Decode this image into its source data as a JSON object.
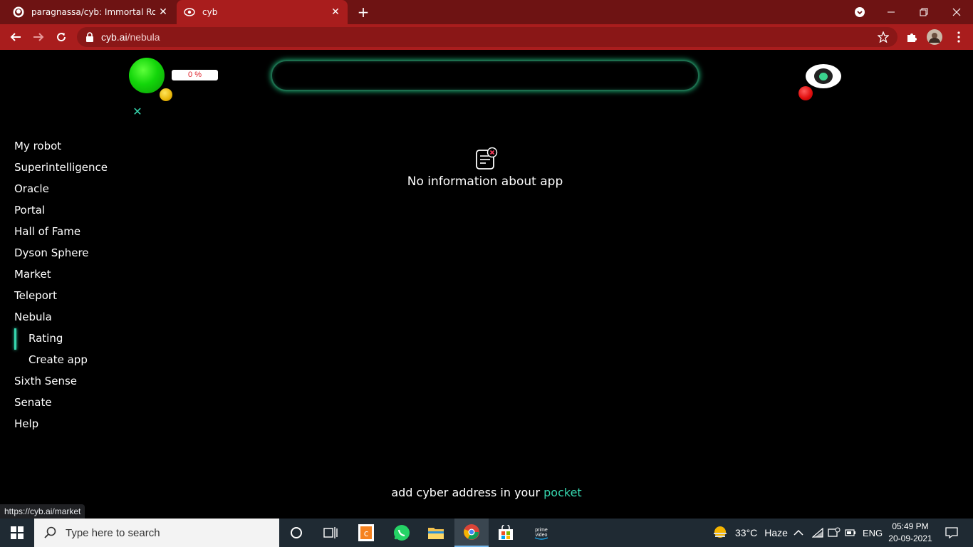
{
  "browser": {
    "tabs": [
      {
        "title": "paragnassa/cyb: Immortal Robot",
        "favicon": "github-icon"
      },
      {
        "title": "cyb",
        "favicon": "cyb-icon"
      }
    ],
    "url_host": "cyb.ai",
    "url_path": "/nebula",
    "colors": {
      "frame": "#6e1313",
      "toolbar": "#a91d1d"
    }
  },
  "header": {
    "progress_label": "0 %"
  },
  "sidebar": {
    "items": [
      {
        "label": "My robot"
      },
      {
        "label": "Superintelligence"
      },
      {
        "label": "Oracle"
      },
      {
        "label": "Portal"
      },
      {
        "label": "Hall of Fame"
      },
      {
        "label": "Dyson Sphere"
      },
      {
        "label": "Market"
      },
      {
        "label": "Teleport"
      },
      {
        "label": "Nebula"
      },
      {
        "label": "Rating",
        "sub": true,
        "active": true
      },
      {
        "label": "Create app",
        "sub": true
      },
      {
        "label": "Sixth Sense"
      },
      {
        "label": "Senate"
      },
      {
        "label": "Help"
      }
    ]
  },
  "main": {
    "empty_message": "No information about app"
  },
  "footer": {
    "prefix": "add cyber address in your ",
    "link": "pocket"
  },
  "status_url": "https://cyb.ai/market",
  "taskbar": {
    "search_placeholder": "Type here to search",
    "weather_temp": "33°C",
    "weather_desc": "Haze",
    "language": "ENG",
    "time": "05:49 PM",
    "date": "20-09-2021"
  },
  "accent": "#36d6ae"
}
